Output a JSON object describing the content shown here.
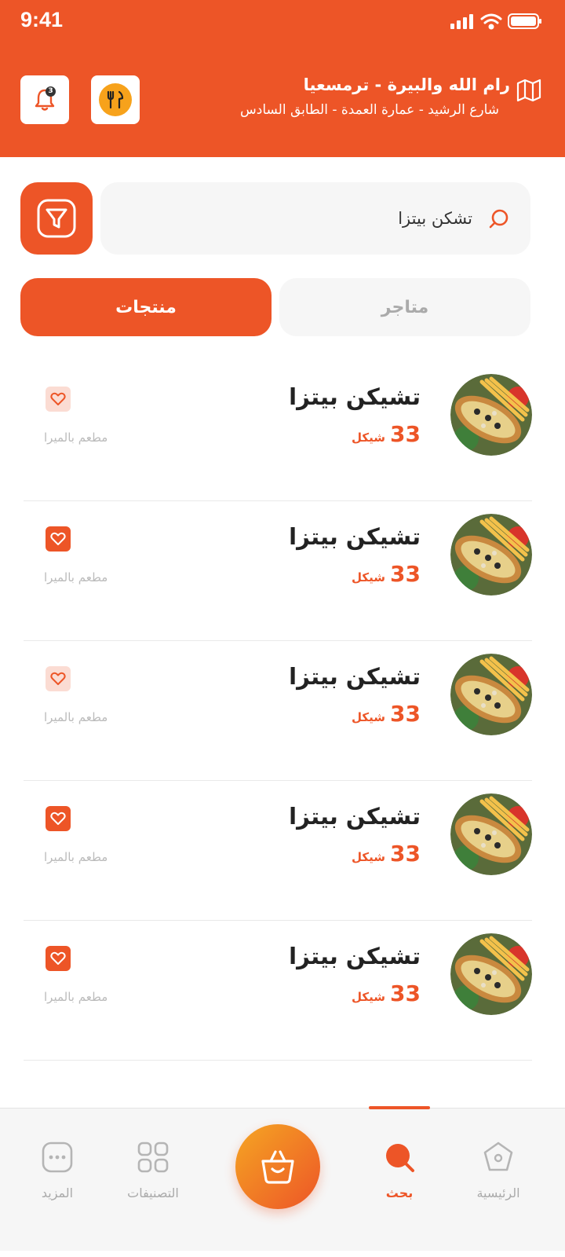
{
  "status_bar": {
    "time": "9:41"
  },
  "header": {
    "location_title": "رام الله والبيرة - ترمسعيا",
    "location_subtitle": "شارع الرشيد - عمارة العمدة - الطابق السادس",
    "notification_count": "3"
  },
  "search": {
    "value": "تشكن بيتزا"
  },
  "tabs": {
    "products": "منتجات",
    "stores": "متاجر",
    "active": "products"
  },
  "products": [
    {
      "name": "تشيكن بيتزا",
      "price": "33",
      "currency": "شيكل",
      "store": "مطعم بالميرا",
      "favorite": false
    },
    {
      "name": "تشيكن بيتزا",
      "price": "33",
      "currency": "شيكل",
      "store": "مطعم بالميرا",
      "favorite": true
    },
    {
      "name": "تشيكن بيتزا",
      "price": "33",
      "currency": "شيكل",
      "store": "مطعم بالميرا",
      "favorite": false
    },
    {
      "name": "تشيكن بيتزا",
      "price": "33",
      "currency": "شيكل",
      "store": "مطعم بالميرا",
      "favorite": true
    },
    {
      "name": "تشيكن بيتزا",
      "price": "33",
      "currency": "شيكل",
      "store": "مطعم بالميرا",
      "favorite": true
    }
  ],
  "bottom_nav": {
    "home": "الرئيسية",
    "search": "بحث",
    "categories": "التصنيفات",
    "more": "المزيد",
    "active": "search"
  },
  "colors": {
    "accent": "#ED5527",
    "accent_light": "#FBDCD3",
    "cart_gradient_start": "#F5A623"
  },
  "icons": [
    "signal-icon",
    "wifi-icon",
    "battery-icon",
    "bell-icon",
    "restaurant-logo-icon",
    "map-icon",
    "search-icon",
    "filter-icon",
    "heart-icon",
    "home-icon",
    "categories-icon",
    "more-icon",
    "basket-icon"
  ]
}
